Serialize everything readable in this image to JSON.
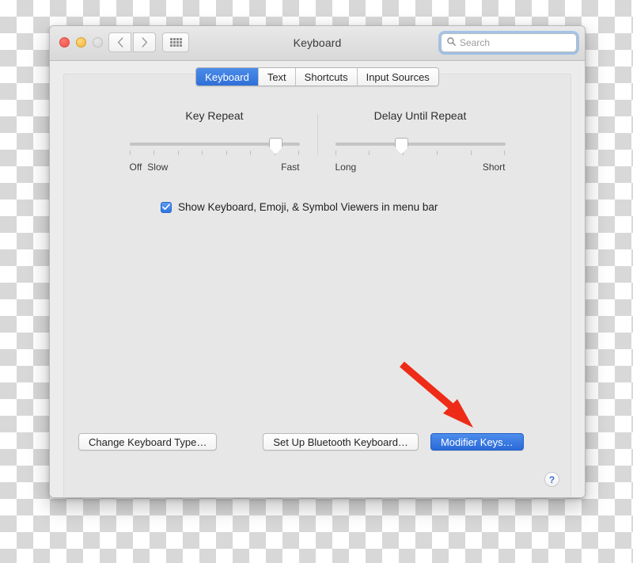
{
  "window": {
    "title": "Keyboard",
    "traffic_lights": [
      "close",
      "minimize",
      "zoom"
    ],
    "nav": {
      "back_icon": "chevron-left-icon",
      "forward_icon": "chevron-right-icon",
      "showall_icon": "grid-icon"
    },
    "search": {
      "placeholder": "Search",
      "icon": "search-icon",
      "value": "",
      "focused": true
    }
  },
  "tabs": [
    {
      "label": "Keyboard",
      "active": true
    },
    {
      "label": "Text",
      "active": false
    },
    {
      "label": "Shortcuts",
      "active": false
    },
    {
      "label": "Input Sources",
      "active": false
    }
  ],
  "sliders": [
    {
      "title": "Key Repeat",
      "left_labels": [
        "Off",
        "Slow"
      ],
      "right_label": "Fast",
      "ticks": 8,
      "value_index": 7,
      "percent": 86
    },
    {
      "title": "Delay Until Repeat",
      "left_labels": [
        "Long"
      ],
      "right_label": "Short",
      "ticks": 6,
      "value_index": 2,
      "percent": 39
    }
  ],
  "checkbox": {
    "label": "Show Keyboard, Emoji, & Symbol Viewers in menu bar",
    "checked": true
  },
  "buttons": [
    {
      "label": "Change Keyboard Type…",
      "style": "default"
    },
    {
      "label": "Set Up Bluetooth Keyboard…",
      "style": "default"
    },
    {
      "label": "Modifier Keys…",
      "style": "primary"
    }
  ],
  "help": {
    "label": "?"
  },
  "annotation": {
    "type": "arrow",
    "color": "#ee2b17",
    "points_to": "Modifier Keys…"
  },
  "colors": {
    "accent_blue": "#2f6fd8",
    "window_bg": "#ececec",
    "panel_bg": "#e7e7e7",
    "annotation_red": "#ee2b17"
  }
}
